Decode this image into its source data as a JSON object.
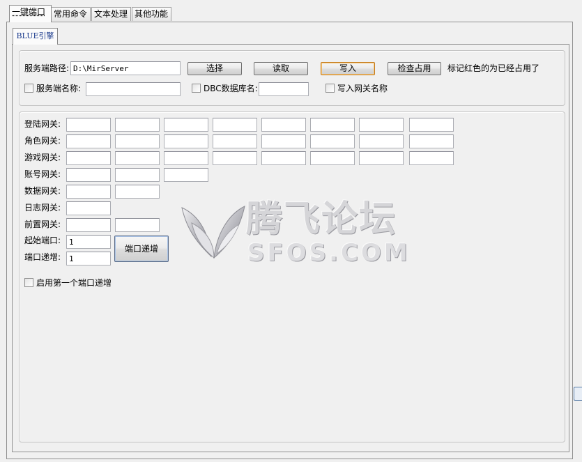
{
  "tabs": [
    {
      "label": "一键端口",
      "active": true
    },
    {
      "label": "常用命令",
      "active": false
    },
    {
      "label": "文本处理",
      "active": false
    },
    {
      "label": "其他功能",
      "active": false
    }
  ],
  "subtab": {
    "label": "BLUE引擎"
  },
  "server_group": {
    "path_label": "服务端路径:",
    "path_value": "D:\\MirServer",
    "select_button": "选择",
    "read_button": "读取",
    "write_button": "写入",
    "check_button": "检查占用",
    "note": "标记红色的为已经占用了",
    "server_name_label": "服务端名称:",
    "server_name_value": "",
    "server_name_checked": false,
    "dbc_label": "DBC数据库名:",
    "dbc_value": "",
    "dbc_checked": false,
    "write_gateway_label": "写入网关名称",
    "write_gateway_checked": false
  },
  "gateways": [
    {
      "label": "登陆网关:",
      "values": [
        "",
        "",
        "",
        "",
        "",
        "",
        "",
        ""
      ]
    },
    {
      "label": "角色网关:",
      "values": [
        "",
        "",
        "",
        "",
        "",
        "",
        "",
        ""
      ]
    },
    {
      "label": "游戏网关:",
      "values": [
        "",
        "",
        "",
        "",
        "",
        "",
        "",
        ""
      ]
    },
    {
      "label": "账号网关:",
      "values": [
        "",
        "",
        ""
      ]
    },
    {
      "label": "数据网关:",
      "values": [
        "",
        ""
      ]
    },
    {
      "label": "日志网关:",
      "values": [
        ""
      ]
    },
    {
      "label": "前置网关:",
      "values": [
        "",
        ""
      ]
    }
  ],
  "port": {
    "start_label": "起始端口:",
    "start_value": "1",
    "step_label": "端口递增:",
    "step_value": "1",
    "increment_button": "端口递增",
    "enable_first_label": "启用第一个端口递增",
    "enable_first_checked": false
  },
  "watermark": {
    "title": "腾飞论坛",
    "subtitle": "SFOS.COM"
  }
}
